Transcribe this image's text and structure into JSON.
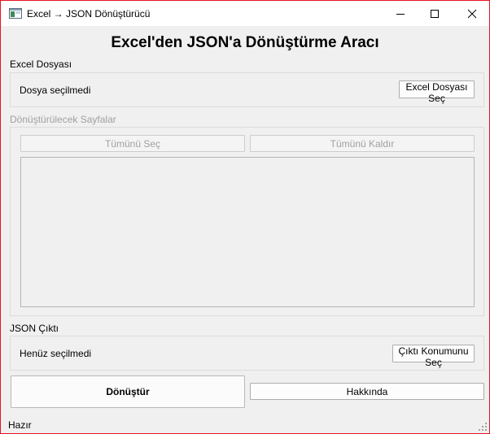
{
  "window": {
    "title": "Excel → JSON Dönüştürücü",
    "controls": {
      "minimize": "minimize-icon",
      "maximize": "maximize-icon",
      "close": "close-icon"
    },
    "accent_border": "#e81123"
  },
  "header": {
    "title": "Excel'den JSON'a Dönüştürme Aracı"
  },
  "excel_section": {
    "label": "Excel Dosyası",
    "status": "Dosya seçilmedi",
    "select_button": "Excel Dosyası Seç"
  },
  "sheets_section": {
    "label": "Dönüştürülecek Sayfalar",
    "select_all": "Tümünü Seç",
    "deselect_all": "Tümünü Kaldır",
    "items": []
  },
  "output_section": {
    "label": "JSON Çıktı",
    "status": "Henüz seçilmedi",
    "select_button": "Çıktı Konumunu Seç"
  },
  "actions": {
    "convert": "Dönüştür",
    "about": "Hakkında"
  },
  "statusbar": {
    "text": "Hazır"
  }
}
